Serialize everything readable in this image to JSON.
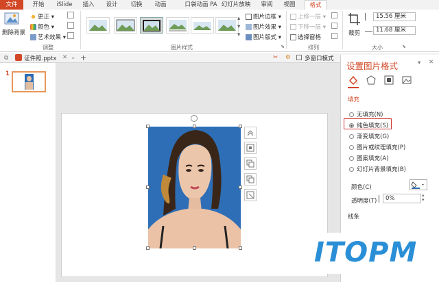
{
  "tabs": [
    "文件",
    "开始",
    "iSlide",
    "插入",
    "设计",
    "切换",
    "动画",
    "口袋动画 PA",
    "幻灯片放映",
    "审阅",
    "视图",
    "格式"
  ],
  "ribbon": {
    "remove_bg": "删除背景",
    "corrections": "更正",
    "color": "颜色",
    "artistic": "艺术效果",
    "adjust_group": "调整",
    "picture_styles_group": "图片样式",
    "picture_border": "图片边框",
    "picture_effects": "图片效果",
    "picture_layout": "图片版式",
    "bring_forward": "上移一层",
    "send_backward": "下移一层",
    "selection_pane": "选择窗格",
    "arrange_group": "排列",
    "crop": "裁剪",
    "height": "15.56 厘米",
    "width": "11.68 厘米",
    "size_group": "大小"
  },
  "doc": {
    "filename": "证件照.pptx",
    "multi_window": "多窗口模式",
    "slide_number": "1"
  },
  "panel": {
    "title": "设置图片格式",
    "section_fill": "填充",
    "options": [
      "无填充(N)",
      "纯色填充(S)",
      "渐变填充(G)",
      "图片或纹理填充(P)",
      "图案填充(A)",
      "幻灯片背景填充(B)"
    ],
    "selected_index": 1,
    "color_label": "颜色(C)",
    "transparency_label": "透明度(T)",
    "transparency_value": "0%",
    "section_line": "线条"
  },
  "watermark": "ITOPM",
  "colors": {
    "accent": "#d24726",
    "photo_bg": "#2d6db5",
    "watermark_blue": "#2a8fd6",
    "watermark_green": "#5cc7a4"
  }
}
